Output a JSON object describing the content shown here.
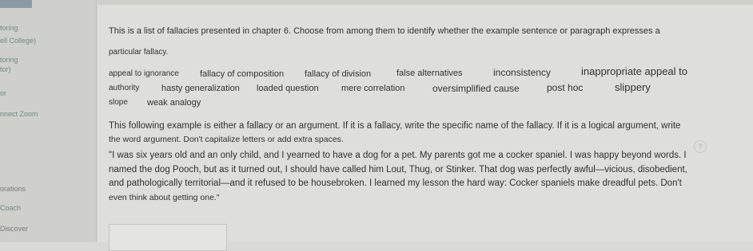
{
  "sidebar": {
    "items": [
      {
        "label": "toring"
      },
      {
        "label": "ell College)"
      },
      {
        "label": "toring"
      },
      {
        "label": "tor)"
      },
      {
        "label": "or"
      },
      {
        "label": "nnect Zoom"
      },
      {
        "label": "orations"
      },
      {
        "label": "Coach"
      },
      {
        "label": "Discover"
      }
    ]
  },
  "question": {
    "intro_line1": "This is a list of fallacies presented in chapter 6. Choose from among them to identify whether the example sentence or paragraph expresses a",
    "intro_line2": "particular fallacy.",
    "fallacies": [
      "appeal to ignorance",
      "fallacy of composition",
      "fallacy of division",
      "false alternatives",
      "inconsistency",
      "inappropriate appeal to",
      "authority",
      "hasty generalization",
      "loaded question",
      "mere correlation",
      "oversimplified cause",
      "post hoc",
      "slippery",
      "slope",
      "weak analogy"
    ],
    "prompt_line1": "This following example is either a fallacy or an argument. If it is a fallacy, write the specific name of the fallacy. If it is a logical argument, write",
    "prompt_line2": "the word argument. Don't capitalize letters or add extra spaces.",
    "example_lines": [
      "\"I was six years old and an only child, and I yearned to have a dog for a pet. My parents got me a cocker spaniel. I was happy beyond words. I",
      "named the dog Pooch, but as it turned out, I should have called him Lout, Thug, or Stinker. That dog was perfectly awful—vicious, disobedient,",
      "and pathologically territorial—and it refused to be housebroken. I learned my lesson the hard way: Cocker spaniels make dreadful pets. Don't",
      "even think about getting one.\""
    ],
    "answer_value": ""
  },
  "icons": {
    "help": "question-mark-icon"
  }
}
